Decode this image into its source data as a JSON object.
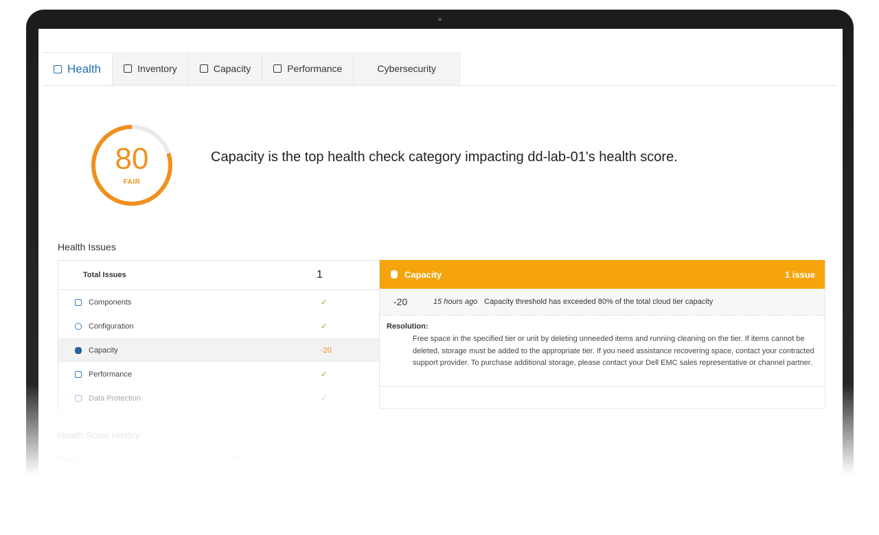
{
  "tabs": [
    {
      "label": "Health",
      "icon": "health-icon"
    },
    {
      "label": "Inventory",
      "icon": "inventory-icon"
    },
    {
      "label": "Capacity",
      "icon": "capacity-icon"
    },
    {
      "label": "Performance",
      "icon": "performance-icon"
    },
    {
      "label": "Cybersecurity",
      "icon": ""
    }
  ],
  "score": {
    "value": "80",
    "label": "FAIR",
    "fraction": 0.8,
    "color": "#f0901e",
    "track_color": "#e9e9e9"
  },
  "headline": "Capacity is the top health check category impacting dd-lab-01's health score.",
  "health_issues": {
    "title": "Health Issues",
    "total_label": "Total Issues",
    "total_value": "1",
    "rows": [
      {
        "label": "Components",
        "value": "✓",
        "icon": "components-icon"
      },
      {
        "label": "Configuration",
        "value": "✓",
        "icon": "configuration-icon"
      },
      {
        "label": "Capacity",
        "value": "-20",
        "icon": "capacity-icon"
      },
      {
        "label": "Performance",
        "value": "✓",
        "icon": "performance-icon"
      },
      {
        "label": "Data Protection",
        "value": "✓",
        "icon": "shield-icon"
      }
    ]
  },
  "detail": {
    "title": "Capacity",
    "count": "1 issue",
    "accent": "#f5a40c",
    "issue": {
      "score": "-20",
      "when": "15 hours ago",
      "message": "Capacity threshold has exceeded 80% of the total cloud tier capacity"
    },
    "resolution_label": "Resolution:",
    "resolution_text": "Free space in the specified tier or unit by deleting unneeded items and running cleaning on the tier. If items cannot be deleted, storage must be added to the appropriate tier. If you need assistance recovering space, contact your contracted support provider. To purchase additional storage, please contact your Dell EMC sales representative or channel partner."
  },
  "history": {
    "title": "Health Score History",
    "from_label": "From",
    "to_label": "To"
  }
}
